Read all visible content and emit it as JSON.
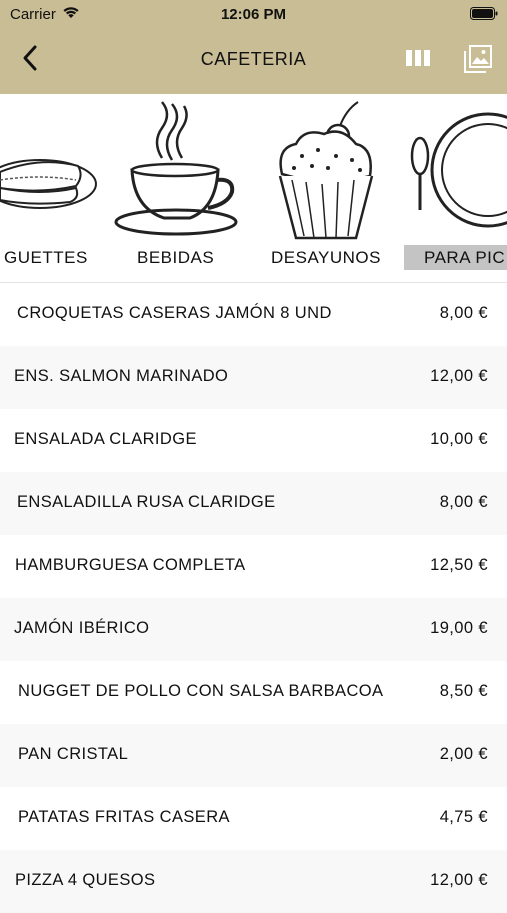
{
  "status": {
    "carrier": "Carrier",
    "time": "12:06 PM"
  },
  "nav": {
    "title": "CAFETERIA",
    "back_icon": "chevron-left-icon",
    "columns_icon": "columns-icon",
    "gallery_icon": "photo-gallery-icon"
  },
  "colors": {
    "header": "#c9bd95",
    "active_category": "#c4c4c4",
    "alt_row": "#f8f8f8"
  },
  "categories": [
    {
      "label": "GUETTES",
      "icon": "baguette-icon",
      "active": false
    },
    {
      "label": "BEBIDAS",
      "icon": "coffee-cup-icon",
      "active": false
    },
    {
      "label": "DESAYUNOS",
      "icon": "cupcake-icon",
      "active": false
    },
    {
      "label": "PARA PIC",
      "icon": "plate-spoon-icon",
      "active": true
    }
  ],
  "items": [
    {
      "name": "CROQUETAS CASERAS JAMÓN 8 UND",
      "price": "8,00 €"
    },
    {
      "name": "ENS. SALMON MARINADO",
      "price": "12,00 €"
    },
    {
      "name": "ENSALADA CLARIDGE",
      "price": "10,00 €"
    },
    {
      "name": "ENSALADILLA RUSA CLARIDGE",
      "price": "8,00 €"
    },
    {
      "name": "HAMBURGUESA COMPLETA",
      "price": "12,50 €"
    },
    {
      "name": "JAMÓN IBÉRICO",
      "price": "19,00 €"
    },
    {
      "name": "NUGGET DE POLLO CON SALSA BARBACOA",
      "price": "8,50 €"
    },
    {
      "name": "PAN CRISTAL",
      "price": "2,00 €"
    },
    {
      "name": "PATATAS FRITAS CASERA",
      "price": "4,75 €"
    },
    {
      "name": "PIZZA 4 QUESOS",
      "price": "12,00 €"
    }
  ]
}
